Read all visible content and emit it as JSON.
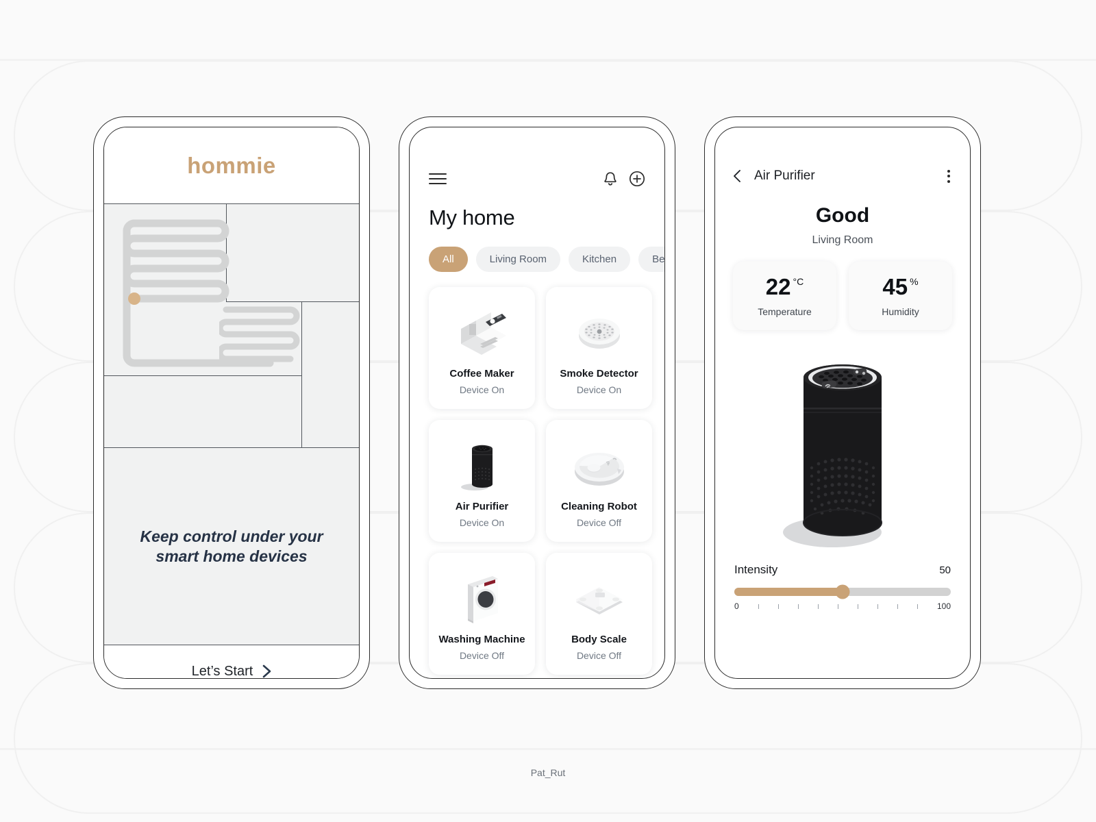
{
  "onboarding": {
    "logo": "hommie",
    "caption": "Keep control under your smart home devices",
    "cta_label": "Let’s Start",
    "cta_icon": "chevron-right-icon",
    "accent_color": "#c9a276"
  },
  "home": {
    "menu_icon": "hamburger-menu-icon",
    "bell_icon": "bell-icon",
    "add_icon": "plus-circle-icon",
    "title": "My home",
    "chips": [
      {
        "label": "All",
        "active": true
      },
      {
        "label": "Living Room",
        "active": false
      },
      {
        "label": "Kitchen",
        "active": false
      },
      {
        "label": "Bedroom",
        "active": false
      }
    ],
    "devices": [
      {
        "name": "Coffee Maker",
        "state": "Device On",
        "icon": "coffee-maker-icon"
      },
      {
        "name": "Smoke Detector",
        "state": "Device On",
        "icon": "smoke-detector-icon"
      },
      {
        "name": "Air Purifier",
        "state": "Device On",
        "icon": "air-purifier-icon"
      },
      {
        "name": "Cleaning Robot",
        "state": "Device Off",
        "icon": "cleaning-robot-icon"
      },
      {
        "name": "Washing Machine",
        "state": "Device Off",
        "icon": "washing-machine-icon"
      },
      {
        "name": "Body Scale",
        "state": "Device Off",
        "icon": "body-scale-icon"
      }
    ]
  },
  "detail": {
    "back_icon": "chevron-left-icon",
    "title": "Air Purifier",
    "menu_icon": "more-vertical-icon",
    "status": "Good",
    "room": "Living Room",
    "metrics": [
      {
        "value": "22",
        "unit": "°C",
        "label": "Temperature"
      },
      {
        "value": "45",
        "unit": "%",
        "label": "Humidity"
      }
    ],
    "product_icon": "air-purifier-hero-image",
    "slider": {
      "label": "Intensity",
      "value": "50",
      "percent": 50,
      "min_label": "0",
      "max_label": "100",
      "ticks": 9
    }
  },
  "footer": {
    "credit": "Pat_Rut"
  }
}
